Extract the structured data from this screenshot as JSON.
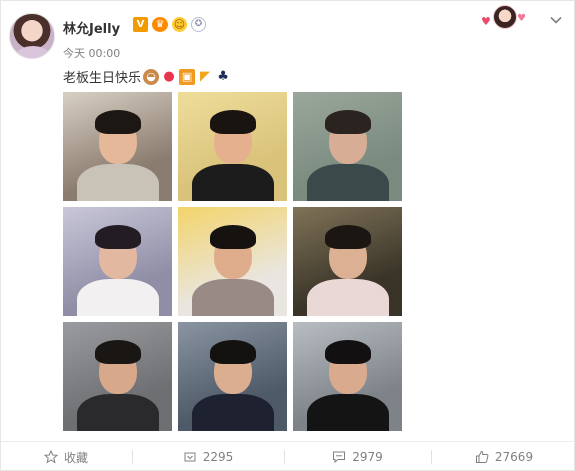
{
  "post": {
    "username": "林允Jelly",
    "timestamp": "今天 00:00",
    "text": "老板生日快乐",
    "badges": [
      "verified-v-icon",
      "vip-level-icon",
      "smile-icon",
      "medal-icon"
    ],
    "emojis": [
      "cake-icon",
      "balloon-icon",
      "gift-icon",
      "party-horn-icon",
      "clover-icon"
    ]
  },
  "photos": [
    {
      "name": "photo-1",
      "bg": "#8a7c6e",
      "accent": "#d8cfc4",
      "hair": "#1d1714",
      "skin": "#e6b89a",
      "body": "#c9c2b6"
    },
    {
      "name": "photo-2",
      "bg": "#d9c27a",
      "accent": "#eedd9a",
      "hair": "#1a1410",
      "skin": "#e4b08d",
      "body": "#1c1c1c"
    },
    {
      "name": "photo-3",
      "bg": "#7a8a7e",
      "accent": "#9aa79c",
      "hair": "#2a2320",
      "skin": "#d7ad96",
      "body": "#3a4a4a"
    },
    {
      "name": "photo-4",
      "bg": "#8f8ea6",
      "accent": "#c9c7d8",
      "hair": "#231c22",
      "skin": "#e2b8a0",
      "body": "#f2f0f0"
    },
    {
      "name": "photo-5",
      "bg": "#e9e6e2",
      "accent": "#f3d46a",
      "hair": "#161210",
      "skin": "#e0ad8c",
      "body": "#9a8a86"
    },
    {
      "name": "photo-6",
      "bg": "#3a3428",
      "accent": "#7f7358",
      "hair": "#1b1612",
      "skin": "#dcb093",
      "body": "#e9d8d6"
    },
    {
      "name": "photo-7",
      "bg": "#6e6f72",
      "accent": "#9a9ba0",
      "hair": "#1a1613",
      "skin": "#d8a88a",
      "body": "#2a2a2c"
    },
    {
      "name": "photo-8",
      "bg": "#4e5a68",
      "accent": "#8a94a2",
      "hair": "#141210",
      "skin": "#dcae90",
      "body": "#1e2230"
    },
    {
      "name": "photo-9",
      "bg": "#7d8388",
      "accent": "#b7bdc2",
      "hair": "#121010",
      "skin": "#d9aa8e",
      "body": "#141414"
    }
  ],
  "actions": {
    "favorite_label": "收藏",
    "repost_count": "2295",
    "comment_count": "2979",
    "like_count": "27669"
  }
}
